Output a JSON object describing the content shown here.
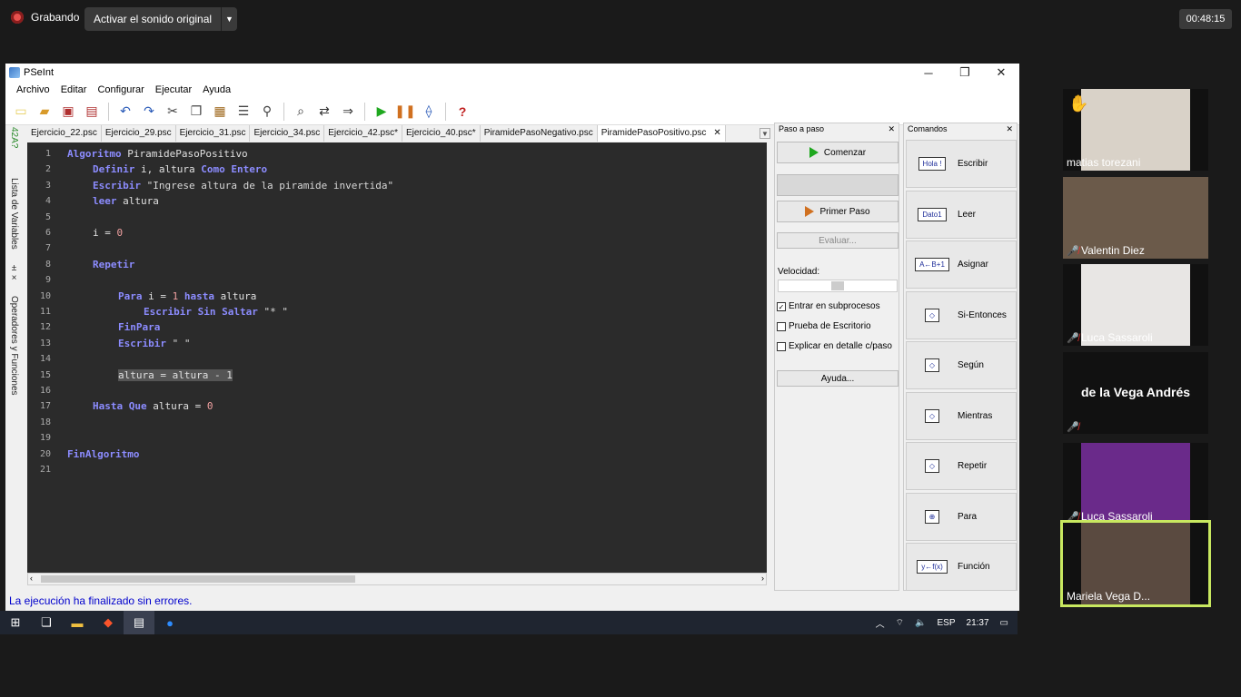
{
  "zoom": {
    "rec_label": "Grabando",
    "audio_label": "Activar el sonido original",
    "timer": "00:48:15"
  },
  "window": {
    "title": "PSeInt",
    "menu": [
      "Archivo",
      "Editar",
      "Configurar",
      "Ejecutar",
      "Ayuda"
    ],
    "left_tabs": [
      "Lista de Variables",
      "Operadores y Funciones"
    ]
  },
  "tabs": [
    {
      "label": "Ejercicio_22.psc"
    },
    {
      "label": "Ejercicio_29.psc"
    },
    {
      "label": "Ejercicio_31.psc"
    },
    {
      "label": "Ejercicio_34.psc"
    },
    {
      "label": "Ejercicio_42.psc*"
    },
    {
      "label": "Ejercicio_40.psc*"
    },
    {
      "label": "PiramidePasoNegativo.psc"
    },
    {
      "label": "PiramidePasoPositivo.psc",
      "active": true
    }
  ],
  "code": [
    {
      "n": "1",
      "indent": 0,
      "parts": [
        [
          "kw",
          "Algoritmo"
        ],
        [
          "t",
          " PiramidePasoPositivo"
        ]
      ]
    },
    {
      "n": "2",
      "indent": 1,
      "parts": [
        [
          "kw",
          "Definir"
        ],
        [
          "t",
          " i, altura "
        ],
        [
          "kw",
          "Como Entero"
        ]
      ]
    },
    {
      "n": "3",
      "indent": 1,
      "parts": [
        [
          "kw",
          "Escribir"
        ],
        [
          "t",
          " "
        ],
        [
          "str",
          "\"Ingrese altura de la piramide invertida\""
        ]
      ]
    },
    {
      "n": "4",
      "indent": 1,
      "parts": [
        [
          "kw",
          "leer"
        ],
        [
          "t",
          " altura"
        ]
      ]
    },
    {
      "n": "5",
      "indent": 0,
      "parts": []
    },
    {
      "n": "6",
      "indent": 1,
      "parts": [
        [
          "t",
          "i = "
        ],
        [
          "num",
          "0"
        ]
      ]
    },
    {
      "n": "7",
      "indent": 0,
      "parts": []
    },
    {
      "n": "8",
      "indent": 1,
      "parts": [
        [
          "kw",
          "Repetir"
        ]
      ]
    },
    {
      "n": "9",
      "indent": 0,
      "parts": []
    },
    {
      "n": "10",
      "indent": 2,
      "parts": [
        [
          "kw",
          "Para"
        ],
        [
          "t",
          " i = "
        ],
        [
          "num",
          "1"
        ],
        [
          "t",
          " "
        ],
        [
          "kw",
          "hasta"
        ],
        [
          "t",
          " altura"
        ]
      ]
    },
    {
      "n": "11",
      "indent": 3,
      "parts": [
        [
          "kw",
          "Escribir Sin Saltar"
        ],
        [
          "t",
          " "
        ],
        [
          "str",
          "\"* \""
        ]
      ]
    },
    {
      "n": "12",
      "indent": 2,
      "parts": [
        [
          "kw",
          "FinPara"
        ]
      ]
    },
    {
      "n": "13",
      "indent": 2,
      "parts": [
        [
          "kw",
          "Escribir"
        ],
        [
          "t",
          " "
        ],
        [
          "str",
          "\" \""
        ]
      ]
    },
    {
      "n": "14",
      "indent": 0,
      "parts": []
    },
    {
      "n": "15",
      "indent": 2,
      "parts": [
        [
          "sel",
          "altura = altura - 1"
        ]
      ]
    },
    {
      "n": "16",
      "indent": 0,
      "parts": []
    },
    {
      "n": "17",
      "indent": 1,
      "parts": [
        [
          "kw",
          "Hasta Que"
        ],
        [
          "t",
          " altura = "
        ],
        [
          "num",
          "0"
        ]
      ]
    },
    {
      "n": "18",
      "indent": 0,
      "parts": []
    },
    {
      "n": "19",
      "indent": 0,
      "parts": []
    },
    {
      "n": "20",
      "indent": 0,
      "parts": [
        [
          "kw",
          "FinAlgoritmo"
        ]
      ]
    },
    {
      "n": "21",
      "indent": 0,
      "parts": []
    }
  ],
  "status": "La ejecución ha finalizado sin errores.",
  "paso": {
    "title": "Paso a paso",
    "comenzar": "Comenzar",
    "primer_paso": "Primer Paso",
    "evaluar": "Evaluar...",
    "velocidad": "Velocidad:",
    "chk1": "Entrar en subprocesos",
    "chk2": "Prueba de Escritorio",
    "chk3": "Explicar en detalle c/paso",
    "ayuda": "Ayuda..."
  },
  "comandos": {
    "title": "Comandos",
    "items": [
      {
        "label": "Escribir",
        "sym": "Hola !"
      },
      {
        "label": "Leer",
        "sym": "Dato1"
      },
      {
        "label": "Asignar",
        "sym": "A←B+1"
      },
      {
        "label": "Si-Entonces",
        "sym": "◇"
      },
      {
        "label": "Según",
        "sym": "◇"
      },
      {
        "label": "Mientras",
        "sym": "◇"
      },
      {
        "label": "Repetir",
        "sym": "◇"
      },
      {
        "label": "Para",
        "sym": "⊕"
      },
      {
        "label": "Función",
        "sym": "y←f(x)"
      }
    ]
  },
  "taskbar": {
    "lang": "ESP",
    "time": "21:37"
  },
  "participants": [
    {
      "name": "matias torezani",
      "muted": false
    },
    {
      "name": "Valentin Diez",
      "muted": true
    },
    {
      "name": "Luca Sassaroli",
      "muted": true
    },
    {
      "name": "de la Vega Andrés",
      "muted": true,
      "no_video": true
    },
    {
      "name": "Luca Sassaroli",
      "muted": true
    },
    {
      "name": "Mariela Vega D...",
      "muted": false,
      "highlight": true
    }
  ]
}
